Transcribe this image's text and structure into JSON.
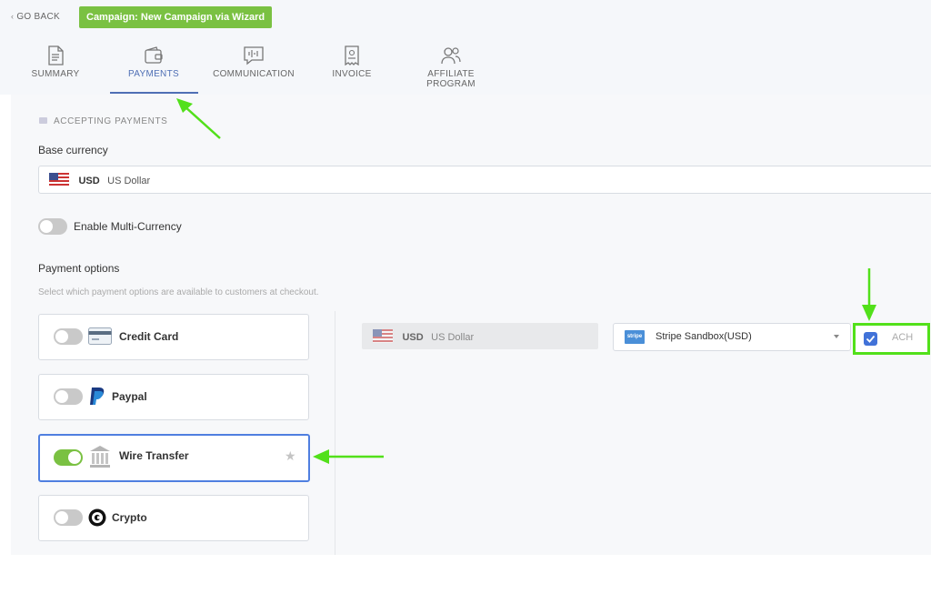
{
  "header": {
    "go_back": "GO BACK",
    "campaign_badge": "Campaign: New Campaign via Wizard",
    "tabs": [
      {
        "label": "SUMMARY",
        "icon": "document-icon"
      },
      {
        "label": "PAYMENTS",
        "icon": "wallet-icon",
        "active": true
      },
      {
        "label": "COMMUNICATION",
        "icon": "chat-waveform-icon"
      },
      {
        "label": "INVOICE",
        "icon": "receipt-icon"
      },
      {
        "label": "AFFILIATE PROGRAM",
        "icon": "users-icon"
      }
    ]
  },
  "accepting": {
    "section_title": "ACCEPTING PAYMENTS",
    "base_currency_label": "Base currency",
    "base_currency": {
      "code": "USD",
      "name": "US Dollar",
      "flag_icon": "us-flag-icon"
    },
    "multi_currency_label": "Enable Multi-Currency",
    "multi_currency_enabled": false,
    "payment_options_label": "Payment options",
    "payment_options_hint": "Select which payment options are available to customers at checkout.",
    "options": [
      {
        "label": "Credit Card",
        "icon": "credit-card-icon",
        "enabled": false
      },
      {
        "label": "Paypal",
        "icon": "paypal-icon",
        "enabled": false
      },
      {
        "label": "Wire Transfer",
        "icon": "bank-icon",
        "enabled": true,
        "selected": true
      },
      {
        "label": "Crypto",
        "icon": "crypto-icon",
        "enabled": false
      }
    ]
  },
  "detail": {
    "currency": {
      "code": "USD",
      "name": "US Dollar"
    },
    "gateway_logo": "stripe",
    "gateway": "Stripe Sandbox(USD)",
    "ach_label": "ACH",
    "ach_checked": true
  },
  "colors": {
    "accent_green": "#7ac142",
    "active_blue": "#4f6fb5",
    "highlight_arrow": "#52e01a",
    "selected_border": "#4f7fe0"
  }
}
